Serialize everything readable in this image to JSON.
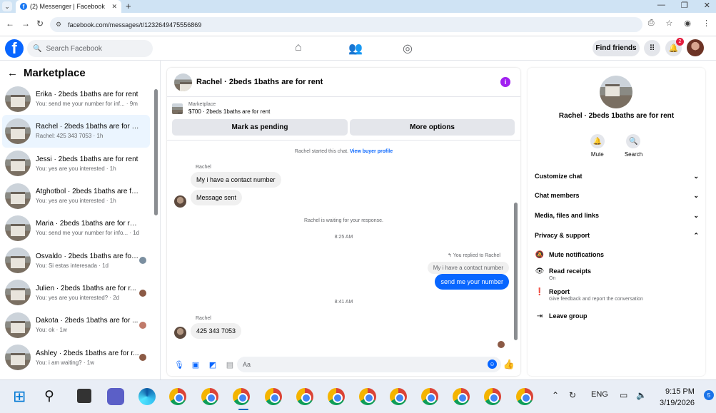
{
  "browser": {
    "tab_title": "(2) Messenger | Facebook",
    "url": "facebook.com/messages/t/1232649475556869"
  },
  "header": {
    "search_placeholder": "Search Facebook",
    "find_friends": "Find friends",
    "notification_count": "2"
  },
  "sidebar": {
    "title": "Marketplace",
    "conversations": [
      {
        "name": "Erika · 2beds 1baths are for rent",
        "preview": "You: send me your number for inf... · 9m"
      },
      {
        "name": "Rachel · 2beds 1baths are for rent",
        "preview": "Rachel: 425 343 7053 · 1h"
      },
      {
        "name": "Jessi · 2beds 1baths are for rent",
        "preview": "You: yes are you interested · 1h"
      },
      {
        "name": "Atghotbol · 2beds 1baths are for...",
        "preview": "You: yes are you interested · 1h"
      },
      {
        "name": "Maria · 2beds 1baths are for rent",
        "preview": "You: send me your number for info... · 1d"
      },
      {
        "name": "Osvaldo · 2beds 1baths are for...",
        "preview": "You: Si estas interesada · 1d"
      },
      {
        "name": "Julien · 2beds 1baths are for r...",
        "preview": "You: yes are you interested? · 2d"
      },
      {
        "name": "Dakota · 2beds 1baths are for ...",
        "preview": "You: ok · 1w"
      },
      {
        "name": "Ashley · 2beds 1baths are for r...",
        "preview": "You: i am waiting? · 1w"
      }
    ]
  },
  "chat": {
    "title": "Rachel · 2beds 1baths are for rent",
    "marketplace_label": "Marketplace",
    "listing": "$700 · 2beds 1baths are for rent",
    "mark_pending": "Mark as pending",
    "more_options": "More options",
    "started": "Rachel started this chat.",
    "view_profile": "View buyer profile",
    "sender1": "Rachel",
    "msg1": "My i have a contact number",
    "msg2": "Message sent",
    "waiting": "Rachel is waiting for your response.",
    "time1": "8:25 AM",
    "replied_note": "You replied to Rachel",
    "quote": "My i have a contact number",
    "out_msg": "send me your number",
    "time2": "8:41 AM",
    "sender2": "Rachel",
    "msg3": "425 343 7053",
    "composer_placeholder": "Aa"
  },
  "details": {
    "name": "Rachel · 2beds 1baths are for rent",
    "mute": "Mute",
    "search": "Search",
    "customize": "Customize chat",
    "members": "Chat members",
    "media": "Media, files and links",
    "privacy": "Privacy & support",
    "mute_notifications": "Mute notifications",
    "read_receipts": "Read receipts",
    "read_receipts_sub": "On",
    "report": "Report",
    "report_sub": "Give feedback and report the conversation",
    "leave": "Leave group"
  },
  "taskbar": {
    "lang": "ENG",
    "time": "9:15 PM",
    "date": "3/19/2026",
    "notif_count": "5"
  }
}
